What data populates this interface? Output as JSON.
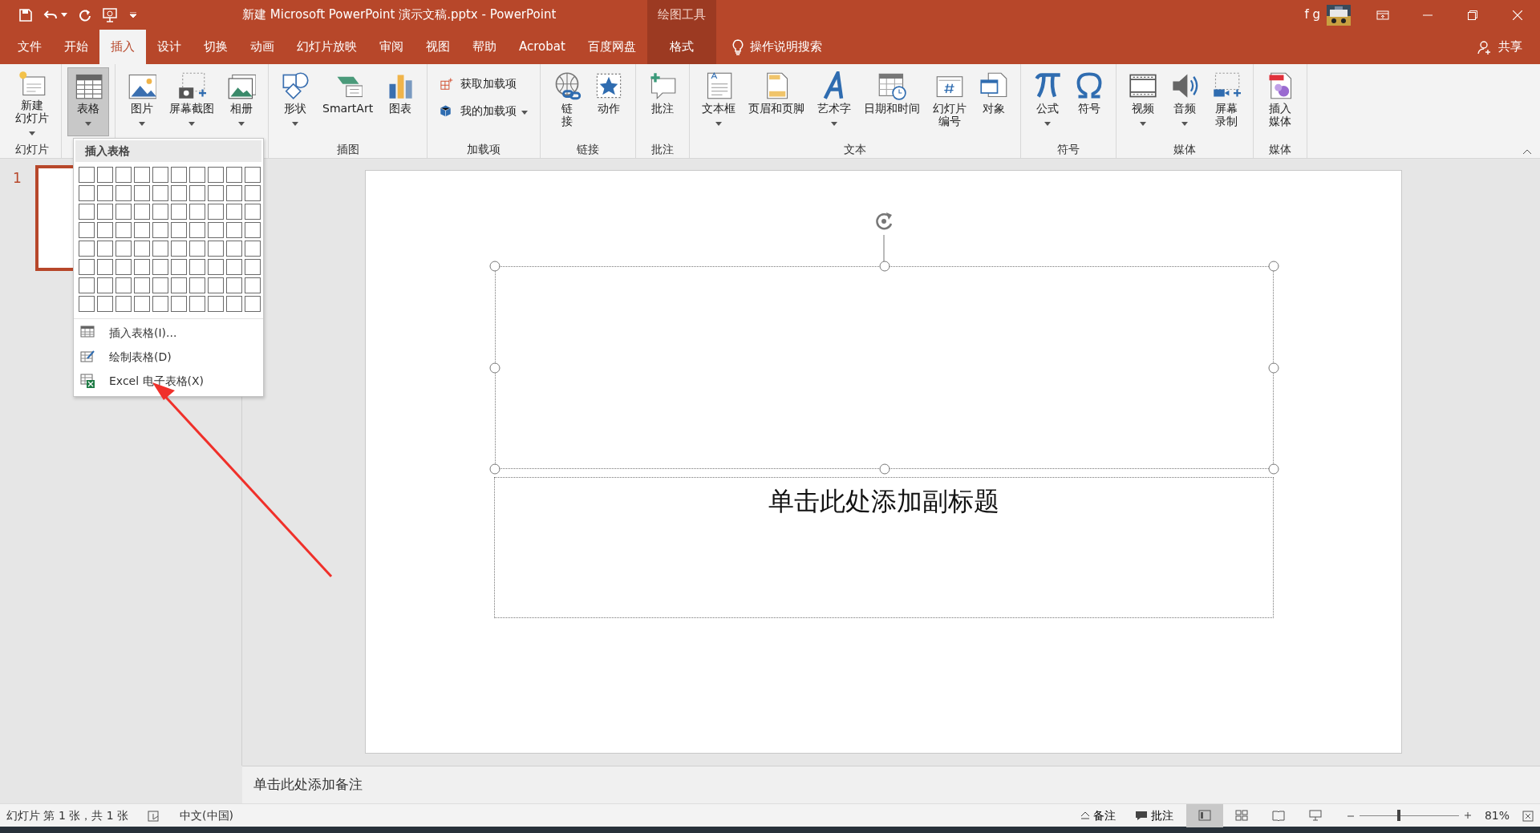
{
  "title_bar": {
    "title": "新建 Microsoft PowerPoint 演示文稿.pptx  -  PowerPoint",
    "contextual_group": "绘图工具",
    "user": "f g"
  },
  "tabs": [
    {
      "label": "文件",
      "selected": false,
      "kind": "normal"
    },
    {
      "label": "开始",
      "selected": false,
      "kind": "normal"
    },
    {
      "label": "插入",
      "selected": true,
      "kind": "normal"
    },
    {
      "label": "设计",
      "selected": false,
      "kind": "normal"
    },
    {
      "label": "切换",
      "selected": false,
      "kind": "normal"
    },
    {
      "label": "动画",
      "selected": false,
      "kind": "normal"
    },
    {
      "label": "幻灯片放映",
      "selected": false,
      "kind": "normal"
    },
    {
      "label": "审阅",
      "selected": false,
      "kind": "normal"
    },
    {
      "label": "视图",
      "selected": false,
      "kind": "normal"
    },
    {
      "label": "帮助",
      "selected": false,
      "kind": "normal"
    },
    {
      "label": "Acrobat",
      "selected": false,
      "kind": "normal"
    },
    {
      "label": "百度网盘",
      "selected": false,
      "kind": "normal"
    },
    {
      "label": "格式",
      "selected": false,
      "kind": "contextual"
    }
  ],
  "search": {
    "placeholder": "操作说明搜索"
  },
  "share": "共享",
  "ribbon_groups": [
    {
      "label": "幻灯片",
      "buttons": [
        {
          "lines": [
            "新建",
            "幻灯片"
          ],
          "dropdown": true,
          "selected": false,
          "kind": "large"
        }
      ]
    },
    {
      "buttons": [
        {
          "lines": [
            "表格"
          ],
          "dropdown": true,
          "selected": true,
          "kind": "large"
        }
      ]
    },
    {
      "buttons": [
        {
          "lines": [
            "图片"
          ],
          "dropdown": true,
          "selected": false,
          "kind": "large"
        },
        {
          "lines": [
            "屏幕截图"
          ],
          "dropdown": true,
          "selected": false,
          "kind": "large"
        },
        {
          "lines": [
            "相册"
          ],
          "dropdown": true,
          "selected": false,
          "kind": "large"
        }
      ]
    },
    {
      "label": "插图",
      "buttons": [
        {
          "lines": [
            "形状"
          ],
          "dropdown": true,
          "selected": false,
          "kind": "large"
        },
        {
          "lines": [
            "SmartArt"
          ],
          "dropdown": false,
          "selected": false,
          "kind": "large"
        },
        {
          "lines": [
            "图表"
          ],
          "dropdown": false,
          "selected": false,
          "kind": "large"
        }
      ]
    },
    {
      "label": "加载项",
      "buttons": [
        {
          "lines": [
            "获取加载项"
          ],
          "dropdown": false,
          "selected": false,
          "kind": "small"
        },
        {
          "lines": [
            "我的加载项"
          ],
          "dropdown": true,
          "selected": false,
          "kind": "small"
        }
      ]
    },
    {
      "label": "链接",
      "buttons": [
        {
          "lines": [
            "链",
            "接"
          ],
          "dropdown": false,
          "selected": false,
          "kind": "large"
        },
        {
          "lines": [
            "动作"
          ],
          "dropdown": false,
          "selected": false,
          "kind": "large"
        }
      ]
    },
    {
      "label": "批注",
      "buttons": [
        {
          "lines": [
            "批注"
          ],
          "dropdown": false,
          "selected": false,
          "kind": "large"
        }
      ]
    },
    {
      "label": "文本",
      "buttons": [
        {
          "lines": [
            "文本框"
          ],
          "dropdown": true,
          "selected": false,
          "kind": "large"
        },
        {
          "lines": [
            "页眉和页脚"
          ],
          "dropdown": false,
          "selected": false,
          "kind": "large"
        },
        {
          "lines": [
            "艺术字"
          ],
          "dropdown": true,
          "selected": false,
          "kind": "large"
        },
        {
          "lines": [
            "日期和时间"
          ],
          "dropdown": false,
          "selected": false,
          "kind": "large"
        },
        {
          "lines": [
            "幻灯片",
            "编号"
          ],
          "dropdown": false,
          "selected": false,
          "kind": "large"
        },
        {
          "lines": [
            "对象"
          ],
          "dropdown": false,
          "selected": false,
          "kind": "large"
        }
      ]
    },
    {
      "label": "符号",
      "buttons": [
        {
          "lines": [
            "公式"
          ],
          "dropdown": true,
          "selected": false,
          "kind": "large"
        },
        {
          "lines": [
            "符号"
          ],
          "dropdown": false,
          "selected": false,
          "kind": "large"
        }
      ]
    },
    {
      "label": "媒体",
      "buttons": [
        {
          "lines": [
            "视频"
          ],
          "dropdown": true,
          "selected": false,
          "kind": "large"
        },
        {
          "lines": [
            "音频"
          ],
          "dropdown": true,
          "selected": false,
          "kind": "large"
        },
        {
          "lines": [
            "屏幕",
            "录制"
          ],
          "dropdown": false,
          "selected": false,
          "kind": "large"
        }
      ]
    },
    {
      "label": "媒体",
      "buttons": [
        {
          "lines": [
            "插入",
            "媒体"
          ],
          "dropdown": false,
          "selected": false,
          "kind": "large"
        }
      ]
    }
  ],
  "table_menu": {
    "header": "插入表格",
    "items": [
      "插入表格(I)...",
      "绘制表格(D)",
      "Excel 电子表格(X)"
    ]
  },
  "slides": [
    {
      "number": "1",
      "selected": true
    }
  ],
  "slide": {
    "subtitle_placeholder": "单击此处添加副标题"
  },
  "notes": {
    "placeholder": "单击此处添加备注"
  },
  "status_bar": {
    "slide_info": "幻灯片 第 1 张，共 1 张",
    "language": "中文(中国)",
    "notes_button": "备注",
    "comments_button": "批注",
    "views": [
      {
        "selected": true
      },
      {
        "selected": false
      },
      {
        "selected": false
      },
      {
        "selected": false
      }
    ],
    "zoom": {
      "level": 0.4
    },
    "zoom_reading": "81%"
  }
}
